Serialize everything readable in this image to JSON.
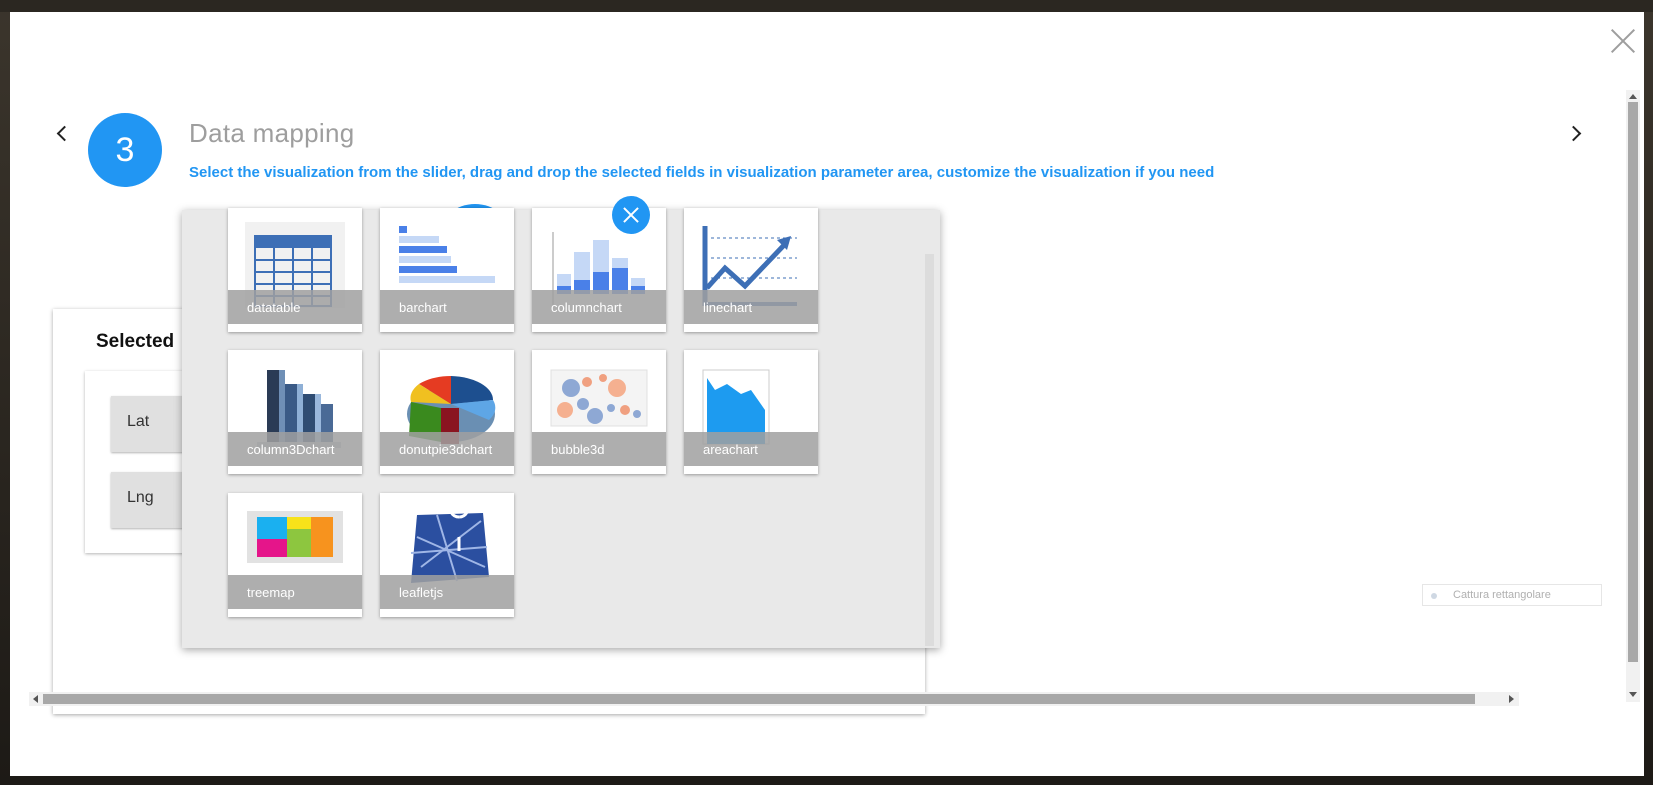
{
  "step": {
    "number": "3",
    "title": "Data mapping",
    "subtitle": "Select the visualization from the slider, drag and drop the selected fields in visualization parameter area, customize the visualization if you need"
  },
  "selected_fields": {
    "title": "Selected",
    "fields": [
      "Lat",
      "Lng"
    ]
  },
  "visualizations": [
    {
      "label": "datatable",
      "icon": "datatable-icon"
    },
    {
      "label": "barchart",
      "icon": "barchart-icon"
    },
    {
      "label": "columnchart",
      "icon": "columnchart-icon"
    },
    {
      "label": "linechart",
      "icon": "linechart-icon"
    },
    {
      "label": "column3Dchart",
      "icon": "column3d-icon"
    },
    {
      "label": "donutpie3dchart",
      "icon": "donutpie3d-icon"
    },
    {
      "label": "bubble3d",
      "icon": "bubble3d-icon"
    },
    {
      "label": "areachart",
      "icon": "areachart-icon"
    },
    {
      "label": "treemap",
      "icon": "treemap-icon"
    },
    {
      "label": "leafletjs",
      "icon": "leafletjs-icon"
    }
  ],
  "snip_badge": "Cattura rettangolare",
  "colors": {
    "accent": "#2196f3",
    "title_gray": "#9e9e9e",
    "panel_bg": "#e9e9e9",
    "tile_label_bg": "#a0a0a0"
  }
}
